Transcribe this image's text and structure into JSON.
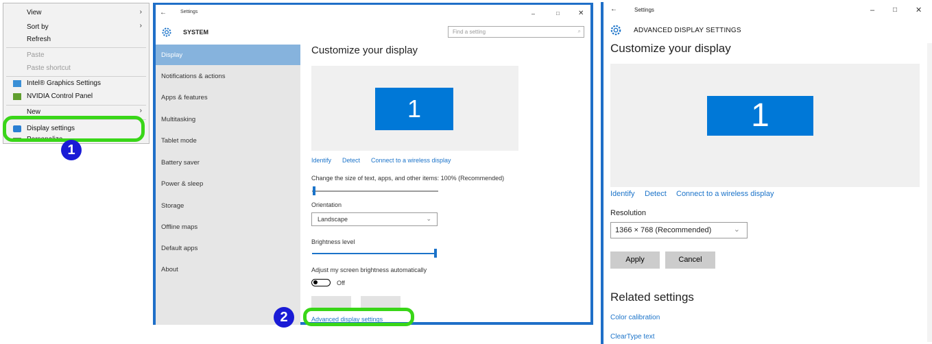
{
  "context_menu": {
    "items": [
      {
        "label": "View",
        "submenu": true
      },
      {
        "label": "Sort by",
        "submenu": true
      },
      {
        "label": "Refresh"
      },
      {
        "label": "Paste",
        "disabled": true
      },
      {
        "label": "Paste shortcut",
        "disabled": true
      },
      {
        "label": "Intel® Graphics Settings",
        "icon": "intel-graphics-icon"
      },
      {
        "label": "NVIDIA Control Panel",
        "icon": "nvidia-icon"
      },
      {
        "label": "New",
        "submenu": true
      },
      {
        "label": "Display settings",
        "icon": "display-icon"
      },
      {
        "label": "Personalize",
        "icon": "personalize-icon"
      }
    ],
    "badge": "1"
  },
  "settings_window": {
    "title": "Settings",
    "header": "SYSTEM",
    "search_placeholder": "Find a setting",
    "sidebar": [
      "Display",
      "Notifications & actions",
      "Apps & features",
      "Multitasking",
      "Tablet mode",
      "Battery saver",
      "Power & sleep",
      "Storage",
      "Offline maps",
      "Default apps",
      "About"
    ],
    "page_title": "Customize your display",
    "monitor_number": "1",
    "links": [
      "Identify",
      "Detect",
      "Connect to a wireless display"
    ],
    "scale_label": "Change the size of text, apps, and other items: 100% (Recommended)",
    "orientation_label": "Orientation",
    "orientation_value": "Landscape",
    "brightness_label": "Brightness level",
    "brightness_level": 1.0,
    "auto_brightness_label": "Adjust my screen brightness automatically",
    "toggle_state": "Off",
    "advanced_link": "Advanced display settings",
    "badge": "2"
  },
  "advanced_window": {
    "title": "Settings",
    "header": "ADVANCED DISPLAY SETTINGS",
    "page_title": "Customize your display",
    "monitor_number": "1",
    "links": [
      "Identify",
      "Detect",
      "Connect to a wireless display"
    ],
    "resolution_label": "Resolution",
    "resolution_value": "1366 × 768 (Recommended)",
    "apply_label": "Apply",
    "cancel_label": "Cancel",
    "related_title": "Related settings",
    "related_links": [
      "Color calibration",
      "ClearType text"
    ]
  },
  "colors": {
    "accent": "#1b73c9",
    "monitor": "#0078d7",
    "callout": "#39d618",
    "badge": "#1a1bd6"
  }
}
